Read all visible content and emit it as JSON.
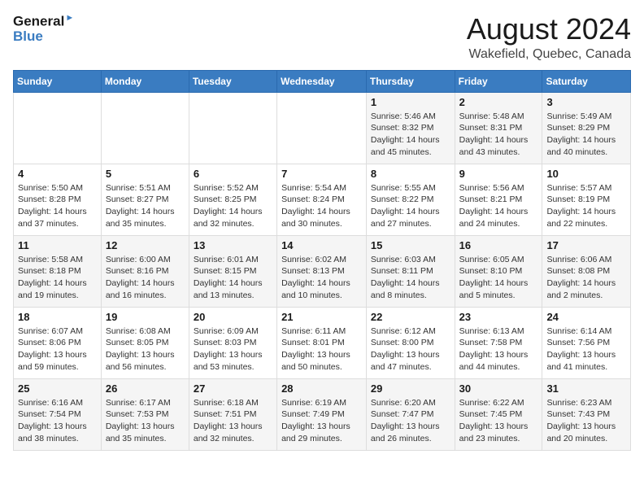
{
  "header": {
    "logo_line1": "General",
    "logo_line2": "Blue",
    "month_year": "August 2024",
    "location": "Wakefield, Quebec, Canada"
  },
  "weekdays": [
    "Sunday",
    "Monday",
    "Tuesday",
    "Wednesday",
    "Thursday",
    "Friday",
    "Saturday"
  ],
  "weeks": [
    [
      {
        "day": "",
        "text": ""
      },
      {
        "day": "",
        "text": ""
      },
      {
        "day": "",
        "text": ""
      },
      {
        "day": "",
        "text": ""
      },
      {
        "day": "1",
        "text": "Sunrise: 5:46 AM\nSunset: 8:32 PM\nDaylight: 14 hours\nand 45 minutes."
      },
      {
        "day": "2",
        "text": "Sunrise: 5:48 AM\nSunset: 8:31 PM\nDaylight: 14 hours\nand 43 minutes."
      },
      {
        "day": "3",
        "text": "Sunrise: 5:49 AM\nSunset: 8:29 PM\nDaylight: 14 hours\nand 40 minutes."
      }
    ],
    [
      {
        "day": "4",
        "text": "Sunrise: 5:50 AM\nSunset: 8:28 PM\nDaylight: 14 hours\nand 37 minutes."
      },
      {
        "day": "5",
        "text": "Sunrise: 5:51 AM\nSunset: 8:27 PM\nDaylight: 14 hours\nand 35 minutes."
      },
      {
        "day": "6",
        "text": "Sunrise: 5:52 AM\nSunset: 8:25 PM\nDaylight: 14 hours\nand 32 minutes."
      },
      {
        "day": "7",
        "text": "Sunrise: 5:54 AM\nSunset: 8:24 PM\nDaylight: 14 hours\nand 30 minutes."
      },
      {
        "day": "8",
        "text": "Sunrise: 5:55 AM\nSunset: 8:22 PM\nDaylight: 14 hours\nand 27 minutes."
      },
      {
        "day": "9",
        "text": "Sunrise: 5:56 AM\nSunset: 8:21 PM\nDaylight: 14 hours\nand 24 minutes."
      },
      {
        "day": "10",
        "text": "Sunrise: 5:57 AM\nSunset: 8:19 PM\nDaylight: 14 hours\nand 22 minutes."
      }
    ],
    [
      {
        "day": "11",
        "text": "Sunrise: 5:58 AM\nSunset: 8:18 PM\nDaylight: 14 hours\nand 19 minutes."
      },
      {
        "day": "12",
        "text": "Sunrise: 6:00 AM\nSunset: 8:16 PM\nDaylight: 14 hours\nand 16 minutes."
      },
      {
        "day": "13",
        "text": "Sunrise: 6:01 AM\nSunset: 8:15 PM\nDaylight: 14 hours\nand 13 minutes."
      },
      {
        "day": "14",
        "text": "Sunrise: 6:02 AM\nSunset: 8:13 PM\nDaylight: 14 hours\nand 10 minutes."
      },
      {
        "day": "15",
        "text": "Sunrise: 6:03 AM\nSunset: 8:11 PM\nDaylight: 14 hours\nand 8 minutes."
      },
      {
        "day": "16",
        "text": "Sunrise: 6:05 AM\nSunset: 8:10 PM\nDaylight: 14 hours\nand 5 minutes."
      },
      {
        "day": "17",
        "text": "Sunrise: 6:06 AM\nSunset: 8:08 PM\nDaylight: 14 hours\nand 2 minutes."
      }
    ],
    [
      {
        "day": "18",
        "text": "Sunrise: 6:07 AM\nSunset: 8:06 PM\nDaylight: 13 hours\nand 59 minutes."
      },
      {
        "day": "19",
        "text": "Sunrise: 6:08 AM\nSunset: 8:05 PM\nDaylight: 13 hours\nand 56 minutes."
      },
      {
        "day": "20",
        "text": "Sunrise: 6:09 AM\nSunset: 8:03 PM\nDaylight: 13 hours\nand 53 minutes."
      },
      {
        "day": "21",
        "text": "Sunrise: 6:11 AM\nSunset: 8:01 PM\nDaylight: 13 hours\nand 50 minutes."
      },
      {
        "day": "22",
        "text": "Sunrise: 6:12 AM\nSunset: 8:00 PM\nDaylight: 13 hours\nand 47 minutes."
      },
      {
        "day": "23",
        "text": "Sunrise: 6:13 AM\nSunset: 7:58 PM\nDaylight: 13 hours\nand 44 minutes."
      },
      {
        "day": "24",
        "text": "Sunrise: 6:14 AM\nSunset: 7:56 PM\nDaylight: 13 hours\nand 41 minutes."
      }
    ],
    [
      {
        "day": "25",
        "text": "Sunrise: 6:16 AM\nSunset: 7:54 PM\nDaylight: 13 hours\nand 38 minutes."
      },
      {
        "day": "26",
        "text": "Sunrise: 6:17 AM\nSunset: 7:53 PM\nDaylight: 13 hours\nand 35 minutes."
      },
      {
        "day": "27",
        "text": "Sunrise: 6:18 AM\nSunset: 7:51 PM\nDaylight: 13 hours\nand 32 minutes."
      },
      {
        "day": "28",
        "text": "Sunrise: 6:19 AM\nSunset: 7:49 PM\nDaylight: 13 hours\nand 29 minutes."
      },
      {
        "day": "29",
        "text": "Sunrise: 6:20 AM\nSunset: 7:47 PM\nDaylight: 13 hours\nand 26 minutes."
      },
      {
        "day": "30",
        "text": "Sunrise: 6:22 AM\nSunset: 7:45 PM\nDaylight: 13 hours\nand 23 minutes."
      },
      {
        "day": "31",
        "text": "Sunrise: 6:23 AM\nSunset: 7:43 PM\nDaylight: 13 hours\nand 20 minutes."
      }
    ]
  ]
}
